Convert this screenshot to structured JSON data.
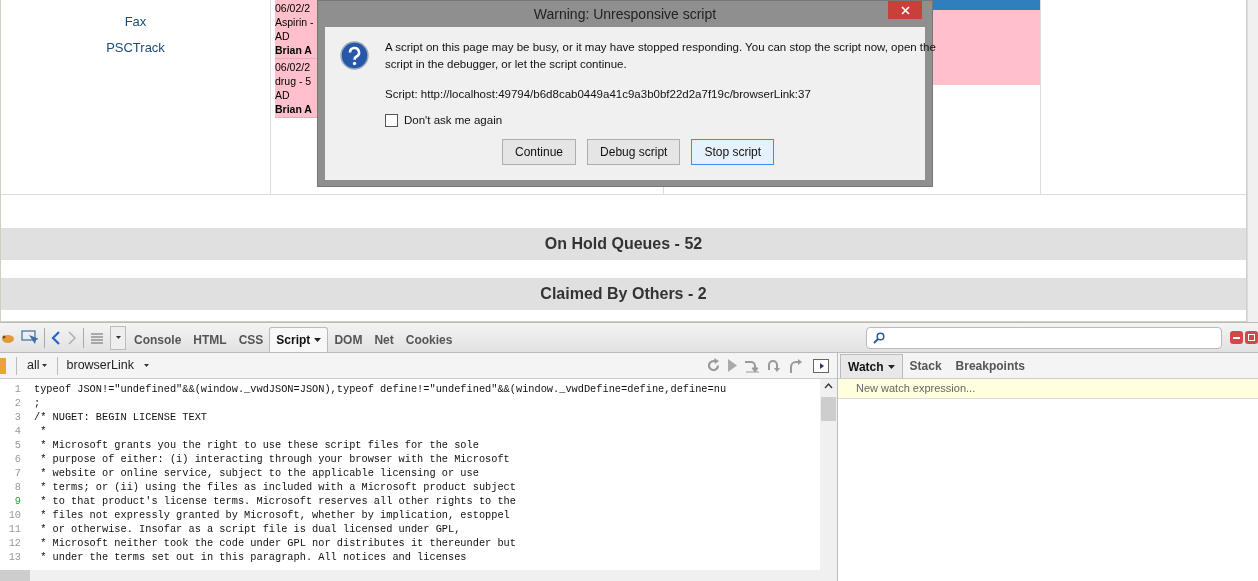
{
  "page": {
    "left_links": [
      "Fax",
      "PSCTrack"
    ],
    "pink_cells": [
      {
        "lines": [
          "06/02/2",
          "Aspirin -",
          "AD"
        ],
        "name": "Brian A"
      },
      {
        "lines": [
          "06/02/2",
          "drug - 5",
          "AD"
        ],
        "name": "Brian A"
      }
    ],
    "sections": [
      "On Hold Queues - 52",
      "Claimed By Others - 2"
    ]
  },
  "dialog": {
    "title": "Warning: Unresponsive script",
    "message": "A script on this page may be busy, or it may have stopped responding. You can stop the script now, open the script in the debugger, or let the script continue.",
    "script_line": "Script: http://localhost:49794/b6d8cab0449a41c9a3b0bf22d2a7f19c/browserLink:37",
    "checkbox": {
      "label": "Don't ask me again",
      "checked": false
    },
    "buttons": [
      {
        "label": "Continue",
        "selected": false
      },
      {
        "label": "Debug script",
        "selected": false
      },
      {
        "label": "Stop script",
        "selected": true
      }
    ]
  },
  "devtools": {
    "tabs": [
      {
        "label": "Console",
        "selected": false
      },
      {
        "label": "HTML",
        "selected": false
      },
      {
        "label": "CSS",
        "selected": false
      },
      {
        "label": "Script",
        "selected": true
      },
      {
        "label": "DOM",
        "selected": false
      },
      {
        "label": "Net",
        "selected": false
      },
      {
        "label": "Cookies",
        "selected": false
      }
    ],
    "filter": "all",
    "file": "browserLink",
    "code": [
      {
        "n": "1",
        "text": "typeof JSON!=\"undefined\"&&(window._vwdJSON=JSON),typeof define!=\"undefined\"&&(window._vwdDefine=define,define=nu",
        "highlighted": false
      },
      {
        "n": "2",
        "text": ";",
        "highlighted": false
      },
      {
        "n": "3",
        "text": "/* NUGET: BEGIN LICENSE TEXT",
        "highlighted": false
      },
      {
        "n": "4",
        "text": " *",
        "highlighted": false
      },
      {
        "n": "5",
        "text": " * Microsoft grants you the right to use these script files for the sole",
        "highlighted": false
      },
      {
        "n": "6",
        "text": " * purpose of either: (i) interacting through your browser with the Microsoft",
        "highlighted": false
      },
      {
        "n": "7",
        "text": " * website or online service, subject to the applicable licensing or use",
        "highlighted": false
      },
      {
        "n": "8",
        "text": " * terms; or (ii) using the files as included with a Microsoft product subject",
        "highlighted": false
      },
      {
        "n": "9",
        "text": " * to that product's license terms. Microsoft reserves all other rights to the",
        "highlighted": true
      },
      {
        "n": "10",
        "text": " * files not expressly granted by Microsoft, whether by implication, estoppel",
        "highlighted": false
      },
      {
        "n": "11",
        "text": " * or otherwise. Insofar as a script file is dual licensed under GPL,",
        "highlighted": false
      },
      {
        "n": "12",
        "text": " * Microsoft neither took the code under GPL nor distributes it thereunder but",
        "highlighted": false
      },
      {
        "n": "13",
        "text": " * under the terms set out in this paragraph. All notices and licenses",
        "highlighted": false
      }
    ],
    "side_tabs": [
      {
        "label": "Watch",
        "selected": true
      },
      {
        "label": "Stack",
        "selected": false
      },
      {
        "label": "Breakpoints",
        "selected": false
      }
    ],
    "watch_placeholder": "New watch expression..."
  }
}
